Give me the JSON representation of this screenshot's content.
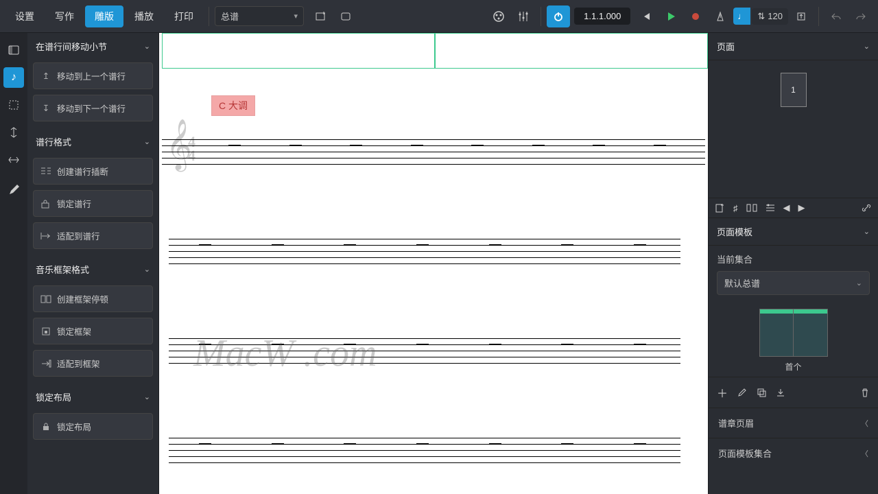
{
  "menu": {
    "tabs": [
      "设置",
      "写作",
      "雕版",
      "播放",
      "打印"
    ],
    "active": 2
  },
  "layout_select": "总谱",
  "transport": {
    "position": "1.1.1.000",
    "tempo": "120"
  },
  "left": {
    "s1": {
      "title": "在谱行间移动小节",
      "b1": "移动到上一个谱行",
      "b2": "移动到下一个谱行"
    },
    "s2": {
      "title": "谱行格式",
      "b1": "创建谱行插断",
      "b2": "锁定谱行",
      "b3": "适配到谱行"
    },
    "s3": {
      "title": "音乐框架格式",
      "b1": "创建框架停顿",
      "b2": "锁定框架",
      "b3": "适配到框架"
    },
    "s4": {
      "title": "锁定布局",
      "b1": "锁定布局"
    }
  },
  "score": {
    "key_flag": "C 大调"
  },
  "right": {
    "pages": "页面",
    "page_num": "1",
    "template_hdr": "页面模板",
    "current_set": "当前集合",
    "set_value": "默认总谱",
    "first": "首个",
    "flow_hdr": "谱章页眉",
    "set_hdr": "页面模板集合"
  },
  "watermark": "MacW .com"
}
